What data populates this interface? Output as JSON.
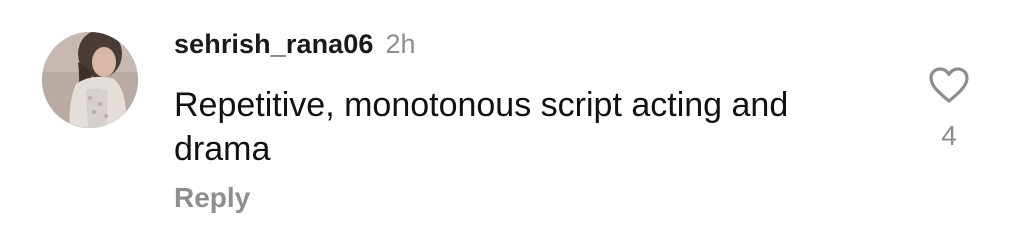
{
  "comment": {
    "avatar_icon": "user-avatar-photo",
    "username": "sehrish_rana06",
    "time": "2h",
    "text": "Repetitive, monotonous script acting and drama",
    "reply_label": "Reply",
    "like_icon": "heart-outline-icon",
    "like_count": "4"
  },
  "colors": {
    "text": "#111111",
    "secondary": "#8e8e8e"
  }
}
